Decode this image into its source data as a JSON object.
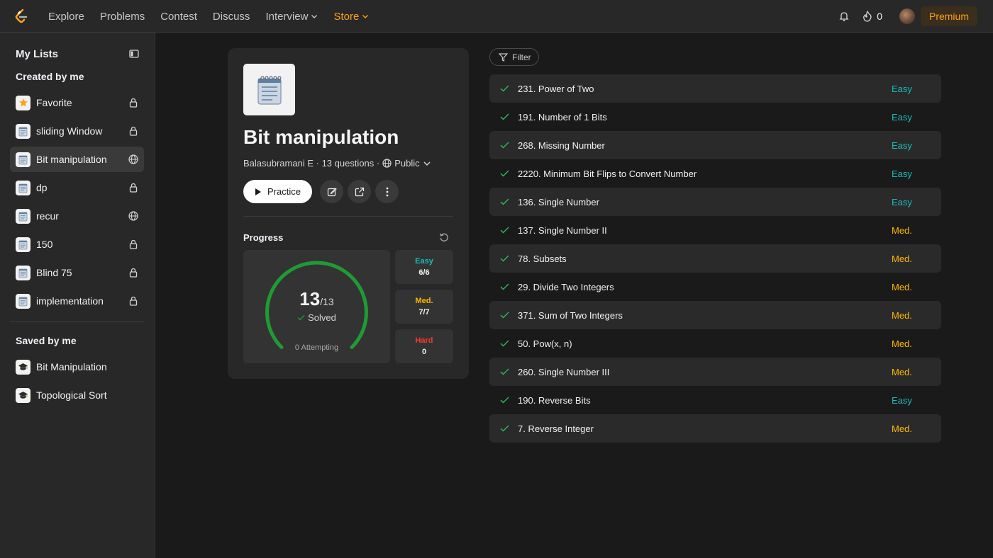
{
  "navbar": {
    "links": [
      {
        "label": "Explore"
      },
      {
        "label": "Problems"
      },
      {
        "label": "Contest"
      },
      {
        "label": "Discuss"
      },
      {
        "label": "Interview"
      },
      {
        "label": "Store"
      }
    ],
    "streak_count": "0",
    "premium_label": "Premium"
  },
  "sidebar": {
    "title": "My Lists",
    "created_heading": "Created by me",
    "created": [
      {
        "label": "Favorite",
        "visibility": "private",
        "icon": "star-icon"
      },
      {
        "label": "sliding Window",
        "visibility": "private",
        "icon": "notepad-icon"
      },
      {
        "label": "Bit manipulation",
        "visibility": "public",
        "icon": "notepad-icon"
      },
      {
        "label": "dp",
        "visibility": "private",
        "icon": "notepad-icon"
      },
      {
        "label": "recur",
        "visibility": "public",
        "icon": "notepad-icon"
      },
      {
        "label": "150",
        "visibility": "private",
        "icon": "notepad-icon"
      },
      {
        "label": "Blind 75",
        "visibility": "private",
        "icon": "notepad-icon"
      },
      {
        "label": "implementation",
        "visibility": "private",
        "icon": "notepad-icon"
      }
    ],
    "saved_heading": "Saved by me",
    "saved": [
      {
        "label": "Bit Manipulation",
        "icon": "graduation-cap-icon"
      },
      {
        "label": "Topological Sort",
        "icon": "graduation-cap-icon"
      }
    ]
  },
  "list_card": {
    "title": "Bit manipulation",
    "author": "Balasubramani E",
    "question_count": "13 questions",
    "visibility": "Public",
    "practice_label": "Practice",
    "progress_label": "Progress",
    "solved": "13",
    "total": "/13",
    "solved_label": "Solved",
    "attempting": "0 Attempting",
    "solved_fraction": 1.0,
    "difficulty": [
      {
        "name": "Easy",
        "count": "6/6",
        "color": "#1cbaba"
      },
      {
        "name": "Med.",
        "count": "7/7",
        "color": "#ffb700"
      },
      {
        "name": "Hard",
        "count": "0",
        "color": "#f63737"
      }
    ]
  },
  "filter_label": "Filter",
  "problems": [
    {
      "title": "231. Power of Two",
      "difficulty": "Easy"
    },
    {
      "title": "191. Number of 1 Bits",
      "difficulty": "Easy"
    },
    {
      "title": "268. Missing Number",
      "difficulty": "Easy"
    },
    {
      "title": "2220. Minimum Bit Flips to Convert Number",
      "difficulty": "Easy"
    },
    {
      "title": "136. Single Number",
      "difficulty": "Easy"
    },
    {
      "title": "137. Single Number II",
      "difficulty": "Med."
    },
    {
      "title": "78. Subsets",
      "difficulty": "Med."
    },
    {
      "title": "29. Divide Two Integers",
      "difficulty": "Med."
    },
    {
      "title": "371. Sum of Two Integers",
      "difficulty": "Med."
    },
    {
      "title": "50. Pow(x, n)",
      "difficulty": "Med."
    },
    {
      "title": "260. Single Number III",
      "difficulty": "Med."
    },
    {
      "title": "190. Reverse Bits",
      "difficulty": "Easy"
    },
    {
      "title": "7. Reverse Integer",
      "difficulty": "Med."
    }
  ],
  "colors": {
    "accent": "#ffa116",
    "easy": "#1cbaba",
    "medium": "#ffb700",
    "hard": "#f63737",
    "solved_ring": "#1e9b34"
  }
}
